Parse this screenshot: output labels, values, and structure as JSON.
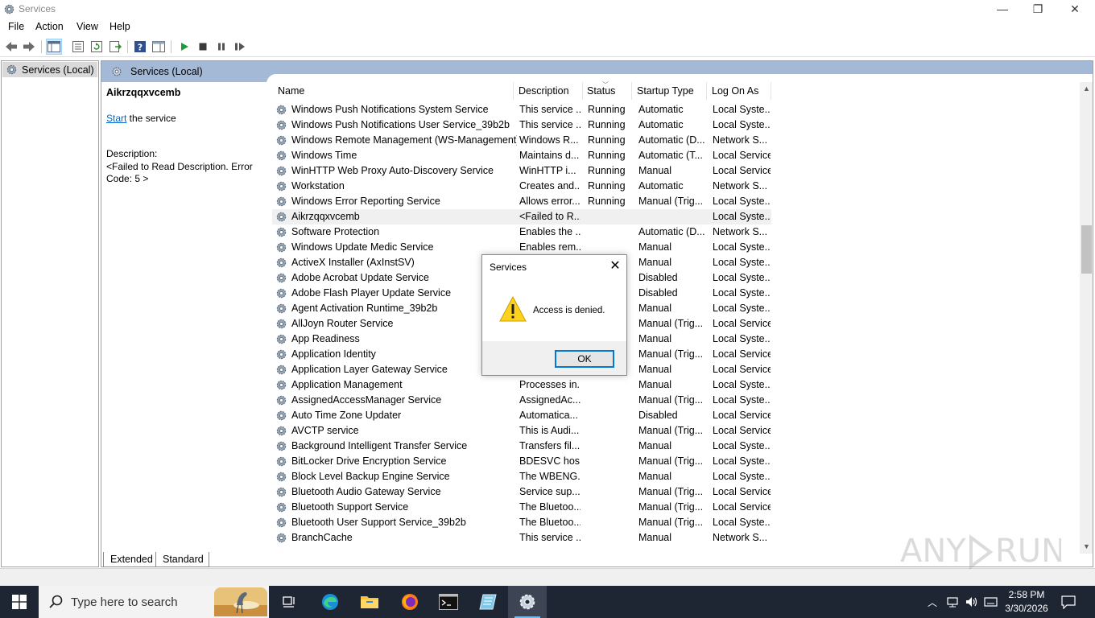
{
  "window": {
    "title": "Services",
    "minimize": "—",
    "maximize": "❐",
    "close": "✕"
  },
  "menu": [
    "File",
    "Action",
    "View",
    "Help"
  ],
  "tree": {
    "root_label": "Services (Local)"
  },
  "main": {
    "header_label": "Services (Local)",
    "selected_service": "Aikrzqqxvcemb",
    "start_link": "Start",
    "start_suffix": " the service",
    "description_label": "Description:",
    "description_text": "<Failed to Read Description. Error Code: 5 >"
  },
  "columns": {
    "name": "Name",
    "description": "Description",
    "status": "Status",
    "startup_type": "Startup Type",
    "log_on_as": "Log On As"
  },
  "services": [
    {
      "name": "Windows Push Notifications System Service",
      "description": "This service ...",
      "status": "Running",
      "startup": "Automatic",
      "logon": "Local Syste..."
    },
    {
      "name": "Windows Push Notifications User Service_39b2b",
      "description": "This service ...",
      "status": "Running",
      "startup": "Automatic",
      "logon": "Local Syste..."
    },
    {
      "name": "Windows Remote Management (WS-Management)",
      "description": "Windows R...",
      "status": "Running",
      "startup": "Automatic (D...",
      "logon": "Network S..."
    },
    {
      "name": "Windows Time",
      "description": "Maintains d...",
      "status": "Running",
      "startup": "Automatic (T...",
      "logon": "Local Service"
    },
    {
      "name": "WinHTTP Web Proxy Auto-Discovery Service",
      "description": "WinHTTP i...",
      "status": "Running",
      "startup": "Manual",
      "logon": "Local Service"
    },
    {
      "name": "Workstation",
      "description": "Creates and...",
      "status": "Running",
      "startup": "Automatic",
      "logon": "Network S..."
    },
    {
      "name": "Windows Error Reporting Service",
      "description": "Allows error...",
      "status": "Running",
      "startup": "Manual (Trig...",
      "logon": "Local Syste..."
    },
    {
      "name": "Aikrzqqxvcemb",
      "description": "<Failed to R...",
      "status": "",
      "startup": "",
      "logon": "Local Syste...",
      "selected": true
    },
    {
      "name": "Software Protection",
      "description": "Enables the ...",
      "status": "",
      "startup": "Automatic (D...",
      "logon": "Network S..."
    },
    {
      "name": "Windows Update Medic Service",
      "description": "Enables rem...",
      "status": "",
      "startup": "Manual",
      "logon": "Local Syste..."
    },
    {
      "name": "ActiveX Installer (AxInstSV)",
      "description": "",
      "status": "",
      "startup": "Manual",
      "logon": "Local Syste..."
    },
    {
      "name": "Adobe Acrobat Update Service",
      "description": "",
      "status": "",
      "startup": "Disabled",
      "logon": "Local Syste..."
    },
    {
      "name": "Adobe Flash Player Update Service",
      "description": "",
      "status": "",
      "startup": "Disabled",
      "logon": "Local Syste..."
    },
    {
      "name": "Agent Activation Runtime_39b2b",
      "description": "",
      "status": "",
      "startup": "Manual",
      "logon": "Local Syste..."
    },
    {
      "name": "AllJoyn Router Service",
      "description": "",
      "status": "",
      "startup": "Manual (Trig...",
      "logon": "Local Service"
    },
    {
      "name": "App Readiness",
      "description": "",
      "status": "",
      "startup": "Manual",
      "logon": "Local Syste..."
    },
    {
      "name": "Application Identity",
      "description": "",
      "status": "",
      "startup": "Manual (Trig...",
      "logon": "Local Service"
    },
    {
      "name": "Application Layer Gateway Service",
      "description": "",
      "status": "",
      "startup": "Manual",
      "logon": "Local Service"
    },
    {
      "name": "Application Management",
      "description": "Processes in...",
      "status": "",
      "startup": "Manual",
      "logon": "Local Syste..."
    },
    {
      "name": "AssignedAccessManager Service",
      "description": "AssignedAc...",
      "status": "",
      "startup": "Manual (Trig...",
      "logon": "Local Syste..."
    },
    {
      "name": "Auto Time Zone Updater",
      "description": "Automatica...",
      "status": "",
      "startup": "Disabled",
      "logon": "Local Service"
    },
    {
      "name": "AVCTP service",
      "description": "This is Audi...",
      "status": "",
      "startup": "Manual (Trig...",
      "logon": "Local Service"
    },
    {
      "name": "Background Intelligent Transfer Service",
      "description": "Transfers fil...",
      "status": "",
      "startup": "Manual",
      "logon": "Local Syste..."
    },
    {
      "name": "BitLocker Drive Encryption Service",
      "description": "BDESVC hos...",
      "status": "",
      "startup": "Manual (Trig...",
      "logon": "Local Syste..."
    },
    {
      "name": "Block Level Backup Engine Service",
      "description": "The WBENG...",
      "status": "",
      "startup": "Manual",
      "logon": "Local Syste..."
    },
    {
      "name": "Bluetooth Audio Gateway Service",
      "description": "Service sup...",
      "status": "",
      "startup": "Manual (Trig...",
      "logon": "Local Service"
    },
    {
      "name": "Bluetooth Support Service",
      "description": "The Bluetoo...",
      "status": "",
      "startup": "Manual (Trig...",
      "logon": "Local Service"
    },
    {
      "name": "Bluetooth User Support Service_39b2b",
      "description": "The Bluetoo...",
      "status": "",
      "startup": "Manual (Trig...",
      "logon": "Local Syste..."
    },
    {
      "name": "BranchCache",
      "description": "This service ...",
      "status": "",
      "startup": "Manual",
      "logon": "Network S..."
    }
  ],
  "tabs": [
    "Extended",
    "Standard"
  ],
  "dialog": {
    "title": "Services",
    "message": "Access is denied.",
    "ok": "OK"
  },
  "taskbar": {
    "search_placeholder": "Type here to search",
    "time": "2:58 PM",
    "date": "3/30/2026"
  },
  "colors": {
    "header_blue": "#a3b9d6",
    "taskbar": "#1f2633",
    "link": "#0066cc",
    "dialog_accent": "#0078d7"
  }
}
